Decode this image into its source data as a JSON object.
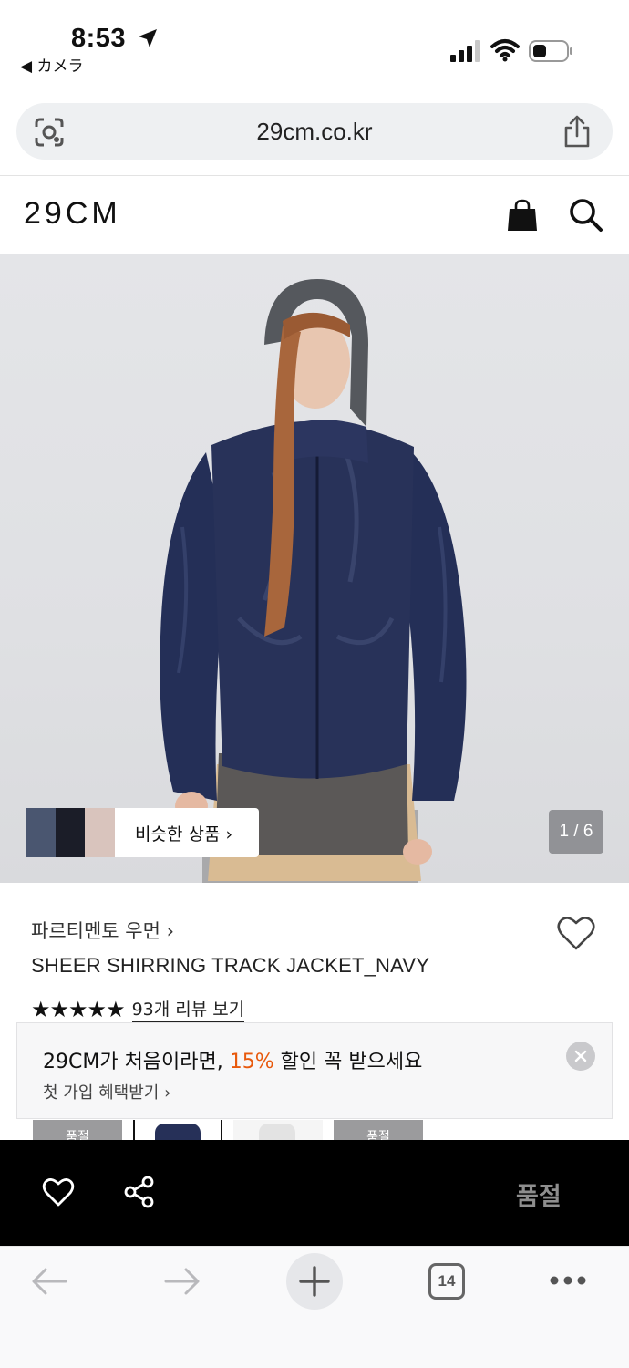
{
  "status_bar": {
    "time": "8:53",
    "back_app": "◀ カメラ"
  },
  "browser": {
    "url": "29cm.co.kr",
    "tab_count": "14"
  },
  "site": {
    "logo": "29CM"
  },
  "product_image": {
    "similar_label": "비슷한 상품 ›",
    "counter": "1 / 6"
  },
  "product": {
    "brand": "파르티멘토 우먼 ›",
    "name": "SHEER SHIRRING TRACK JACKET_NAVY",
    "stars": "★★★★★",
    "review_link": "93개 리뷰 보기"
  },
  "promo": {
    "title_prefix": "29CM가 처음이라면, ",
    "title_accent": "15%",
    "title_suffix": " 할인 꼭 받으세요",
    "subtitle": "첫 가입 혜택받기 ›",
    "accent_color": "#e8590c"
  },
  "swatches": [
    {
      "label": "품절"
    },
    {
      "label": ""
    },
    {
      "label": ""
    },
    {
      "label": "품절"
    }
  ],
  "action_bar": {
    "soldout_label": "품절"
  }
}
